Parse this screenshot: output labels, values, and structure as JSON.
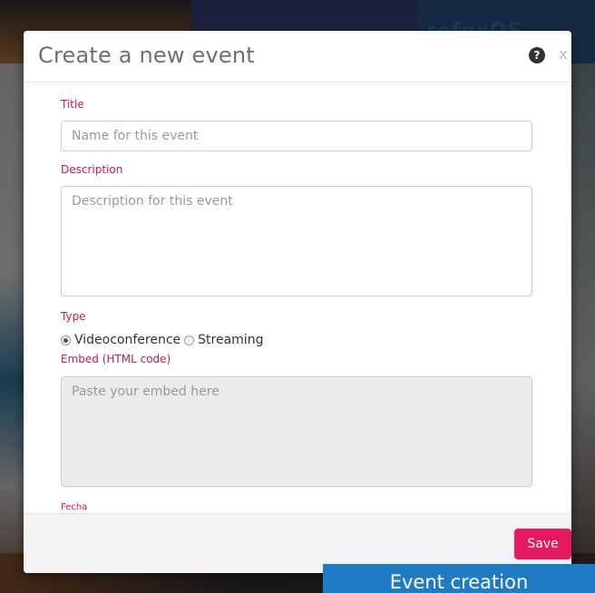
{
  "modal": {
    "title": "Create a new event",
    "help_icon": "question-circle-icon",
    "help_glyph": "?",
    "close_icon": "close-icon",
    "close_glyph": "x"
  },
  "form": {
    "title": {
      "label": "Title",
      "placeholder": "Name for this event"
    },
    "description": {
      "label": "Description",
      "placeholder": "Description for this event"
    },
    "type": {
      "label": "Type",
      "options": [
        {
          "label": "Videoconference",
          "checked": true
        },
        {
          "label": "Streaming",
          "checked": false
        }
      ]
    },
    "embed": {
      "label": "Embed (HTML code)",
      "placeholder": "Paste your embed here"
    },
    "fecha": {
      "label": "Fecha"
    }
  },
  "footer": {
    "save_label": "Save"
  },
  "caption": {
    "text": "Event creation"
  },
  "background": {
    "text": "refoxOS"
  },
  "colors": {
    "accent": "#e5195f",
    "label": "#c2185b",
    "caption_bg": "#1e7bc4"
  }
}
